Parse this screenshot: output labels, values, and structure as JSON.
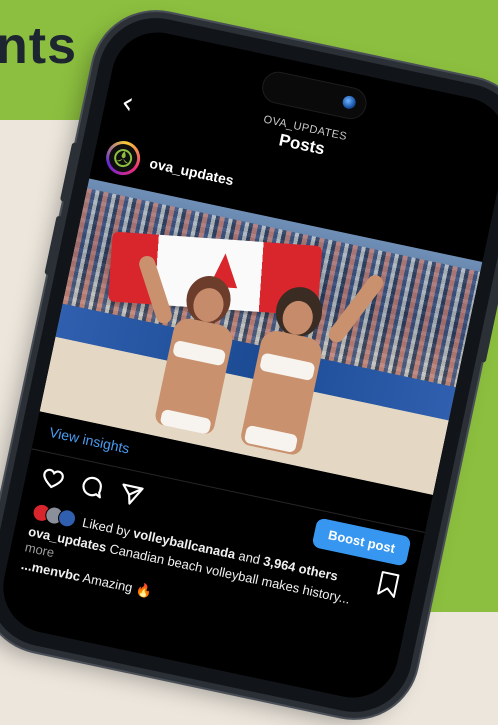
{
  "background": {
    "headline": "nts",
    "colors": {
      "green": "#8cbf3f",
      "cream": "#ece6dc",
      "dark_text": "#1c2530",
      "yellow": "#f4c21c"
    }
  },
  "header": {
    "overline": "OVA_UPDATES",
    "title": "Posts",
    "back_icon": "chevron-left-icon"
  },
  "post": {
    "username": "ova_updates",
    "more_icon": "more-horizontal-icon",
    "photo_description_icon": "photo"
  },
  "insights": {
    "label": "View insights"
  },
  "actions": {
    "icons": [
      "heart-icon",
      "comment-icon",
      "share-icon",
      "bookmark-icon"
    ],
    "boost_label": "Boost post"
  },
  "likes": {
    "prefix": "Liked by",
    "user": "volleyballcanada",
    "middle": "and",
    "count": "3,964 others"
  },
  "caption": {
    "user": "ova_updates",
    "text": "Canadian beach volleyball makes history...",
    "more": "more"
  },
  "comment": {
    "user": "...menvbc",
    "text": "Amazing"
  },
  "accent_color": "#3797f0"
}
